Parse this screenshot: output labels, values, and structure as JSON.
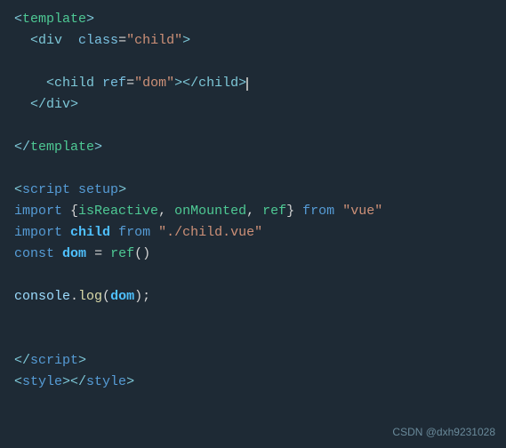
{
  "code": {
    "lines": [
      {
        "id": "line1",
        "content": "template_open"
      },
      {
        "id": "line2",
        "content": "div_open"
      },
      {
        "id": "line3",
        "content": "blank"
      },
      {
        "id": "line4",
        "content": "child_tag"
      },
      {
        "id": "line5",
        "content": "div_close"
      },
      {
        "id": "line6",
        "content": "blank"
      },
      {
        "id": "line7",
        "content": "template_close"
      },
      {
        "id": "line8",
        "content": "blank"
      },
      {
        "id": "line9",
        "content": "script_open"
      },
      {
        "id": "line10",
        "content": "import1"
      },
      {
        "id": "line11",
        "content": "import2"
      },
      {
        "id": "line12",
        "content": "const_dom"
      },
      {
        "id": "line13",
        "content": "blank"
      },
      {
        "id": "line14",
        "content": "console_log"
      },
      {
        "id": "line15",
        "content": "blank"
      },
      {
        "id": "line16",
        "content": "blank"
      },
      {
        "id": "line17",
        "content": "script_close"
      },
      {
        "id": "line18",
        "content": "style_tag"
      }
    ],
    "watermark": "CSDN @dxh9231028"
  }
}
